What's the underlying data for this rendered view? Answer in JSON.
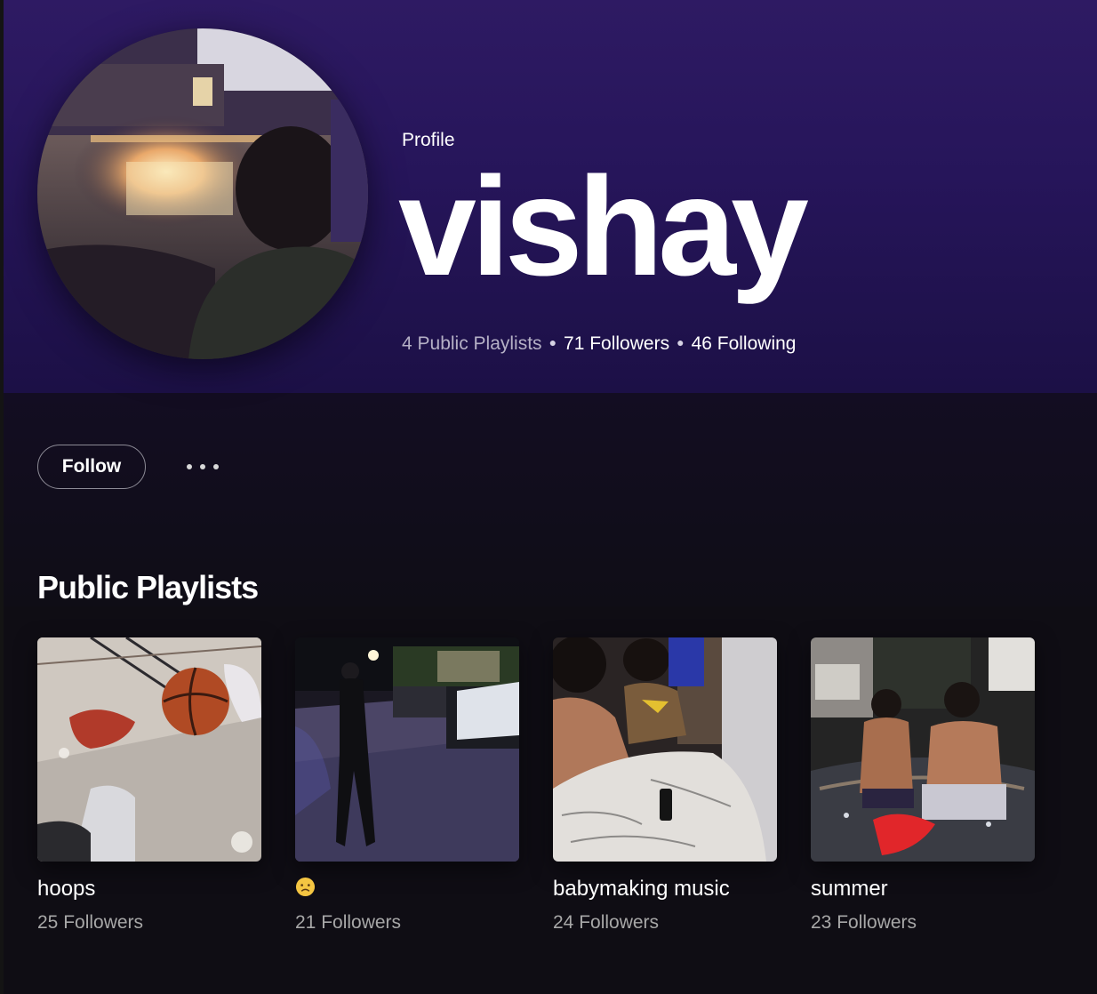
{
  "profile": {
    "type_label": "Profile",
    "display_name": "vishay",
    "stats": {
      "playlists": "4 Public Playlists",
      "followers": "71 Followers",
      "following": "46 Following"
    },
    "avatar_alt": "profile-photo"
  },
  "actions": {
    "follow_label": "Follow",
    "more_icon": "more-options-icon"
  },
  "section": {
    "title": "Public Playlists"
  },
  "playlists": [
    {
      "title": "hoops",
      "followers": "25 Followers",
      "cover": "basketball-court-photo"
    },
    {
      "title": "☹️",
      "followers": "21 Followers",
      "cover": "night-parking-lot-photo"
    },
    {
      "title": "babymaking music",
      "followers": "24 Followers",
      "cover": "friends-in-bed-photo"
    },
    {
      "title": "summer",
      "followers": "23 Followers",
      "cover": "hot-tub-photo"
    }
  ],
  "colors": {
    "header_top": "#2e1a63",
    "header_bottom": "#1c1046",
    "page_bg": "#0f0d14",
    "muted_text": "#a7a7a7",
    "stats_text": "#b5b0c6"
  }
}
